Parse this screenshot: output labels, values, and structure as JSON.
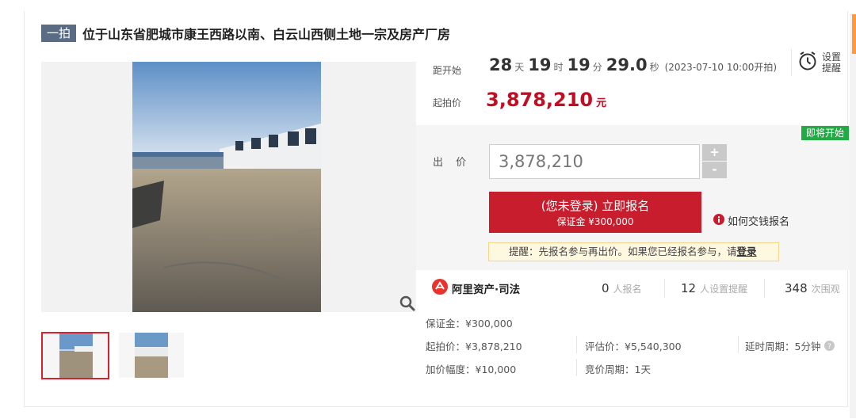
{
  "title": {
    "tag": "一拍",
    "text": "位于山东省肥城市康王西路以南、白云山西侧土地一宗及房产厂房"
  },
  "countdown": {
    "label": "距开始",
    "days": "28",
    "days_unit": "天",
    "hours": "19",
    "hours_unit": "时",
    "minutes": "19",
    "minutes_unit": "分",
    "seconds": "29.0",
    "seconds_unit": "秒",
    "start_note": "(2023-07-10 10:00开拍)"
  },
  "reminder": {
    "label": "设置提醒",
    "icon": "alarm-clock-icon"
  },
  "start_price": {
    "label": "起拍价",
    "value": "3,878,210",
    "unit": "元"
  },
  "bid": {
    "status_tag": "即将开始",
    "label": "出 价",
    "input_value": "3,878,210",
    "plus": "+",
    "minus": "-"
  },
  "signup": {
    "line1": "(您未登录) 立即报名",
    "line2": "保证金 ¥300,000"
  },
  "howto": {
    "text": "如何交钱报名",
    "icon": "info-icon"
  },
  "notice": {
    "text": "提醒：先报名参与再出价。如果您已经报名参与，请",
    "link": "登录"
  },
  "platform": {
    "name": "阿里资产·司法",
    "icon": "ali-logo-icon"
  },
  "stats": [
    {
      "count": "0",
      "label": "人报名"
    },
    {
      "count": "12",
      "label": "人设置提醒"
    },
    {
      "count": "348",
      "label": "次围观"
    }
  ],
  "details": {
    "deposit": "保证金：¥300,000",
    "start_price": "起拍价：¥3,878,210",
    "appraisal": "评估价：¥5,540,300",
    "delay_period": "延时周期：5分钟",
    "increment": "加价幅度：¥10,000",
    "bid_period": "竞价周期：1天"
  },
  "colors": {
    "accent_red": "#c81d2c",
    "price_red": "#c40d22",
    "tag_green": "#22ab45",
    "tag_slate": "#5a6c83"
  }
}
